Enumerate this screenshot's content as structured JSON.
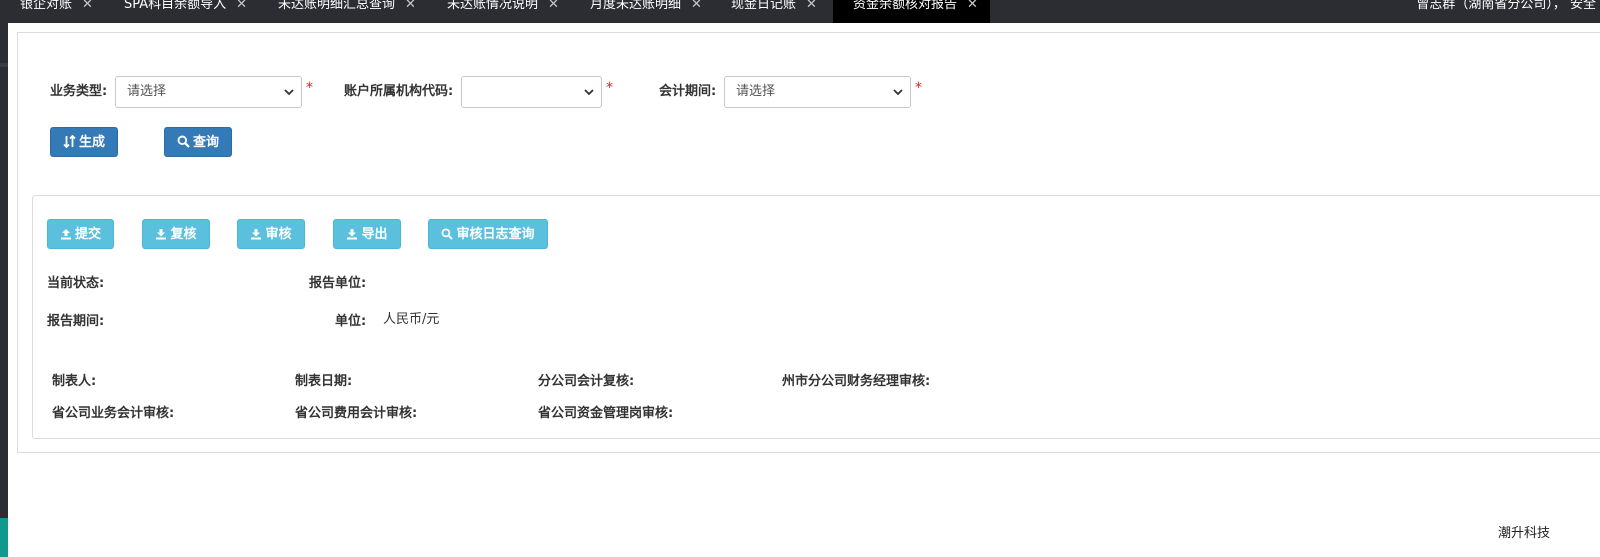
{
  "tabs": [
    {
      "label": "银企对账",
      "active": false
    },
    {
      "label": "SPA科目余额导入",
      "active": false
    },
    {
      "label": "未达账明细汇总查询",
      "active": false
    },
    {
      "label": "未达账情况说明",
      "active": false
    },
    {
      "label": "月度未达账明细",
      "active": false
    },
    {
      "label": "现金日记账",
      "active": false
    },
    {
      "label": "资金余额核对报告",
      "active": true
    }
  ],
  "tab_close_glyph": "✕",
  "user": {
    "text": "曾志群（湖南省分公司），",
    "extra": "安全"
  },
  "filters": {
    "business_type": {
      "label": "业务类型:",
      "value": "请选择",
      "required": "*"
    },
    "org_code": {
      "label": "账户所属机构代码:",
      "value": "",
      "required": "*"
    },
    "period": {
      "label": "会计期间:",
      "value": "请选择",
      "required": "*"
    }
  },
  "actions": {
    "generate": {
      "label": "生成",
      "icon": "sort-icon"
    },
    "query": {
      "label": "查询",
      "icon": "search-icon"
    }
  },
  "toolbar": {
    "submit": {
      "label": "提交",
      "icon": "upload-icon"
    },
    "recheck": {
      "label": "复核",
      "icon": "download-icon"
    },
    "audit": {
      "label": "审核",
      "icon": "download-icon"
    },
    "export": {
      "label": "导出",
      "icon": "download-icon"
    },
    "audit_log": {
      "label": "审核日志查询",
      "icon": "search-icon"
    }
  },
  "report": {
    "status_label": "当前状态:",
    "unit_label": "报告单位:",
    "period_label": "报告期间:",
    "currency_label": "单位:",
    "currency_value": "人民币/元"
  },
  "signoffs": {
    "preparer": "制表人:",
    "prepare_date": "制表日期:",
    "branch_recheck": "分公司会计复核:",
    "city_manager": "州市分公司财务经理审核:",
    "prov_business": "省公司业务会计审核:",
    "prov_expense": "省公司费用会计审核:",
    "prov_fund": "省公司资金管理岗审核:"
  },
  "brand": "潮升科技",
  "colors": {
    "primary": "#337ab7",
    "info": "#5bc0de",
    "tabbar": "#2b2d33",
    "required": "#e02020"
  }
}
